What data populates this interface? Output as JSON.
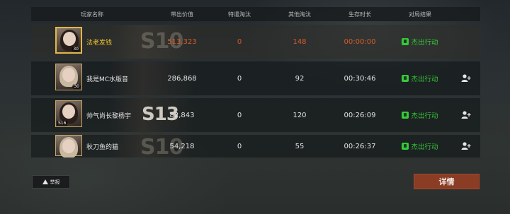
{
  "header": {
    "player_name": "玩家名称",
    "carried_value": "带出价值",
    "special_kills": "特遣淘汰",
    "other_kills": "其他淘汰",
    "survival_time": "生存时长",
    "result": "对局结果"
  },
  "rows": [
    {
      "name": "法老发钱",
      "value": "513,323",
      "special": "0",
      "other": "148",
      "time": "00:00:00",
      "result": "杰出行动",
      "level": "30",
      "season": "S10",
      "highlight": true
    },
    {
      "name": "我是MC水版音",
      "value": "286,868",
      "special": "0",
      "other": "92",
      "time": "00:30:46",
      "result": "杰出行动",
      "level": "30",
      "season": "",
      "highlight": false
    },
    {
      "name": "帅气尚长黎杨宇",
      "value": "82,843",
      "special": "0",
      "other": "120",
      "time": "00:26:09",
      "result": "杰出行动",
      "level": "S16",
      "season": "S13",
      "highlight": false
    },
    {
      "name": "秋刀鱼的猫",
      "value": "54,218",
      "special": "0",
      "other": "55",
      "time": "00:26:37",
      "result": "杰出行动",
      "level": "",
      "season": "S10",
      "highlight": false
    }
  ],
  "icons": {
    "avatar": "player-avatar",
    "result": "success-icon",
    "add_friend": "add-friend-icon",
    "report": "warning-icon"
  },
  "colors": {
    "accent": "#8a3c25",
    "success": "#36c93a",
    "highlight_name": "#f2c230",
    "highlight_value": "#d65a2b"
  },
  "buttons": {
    "report": "举报",
    "details": "详情"
  }
}
